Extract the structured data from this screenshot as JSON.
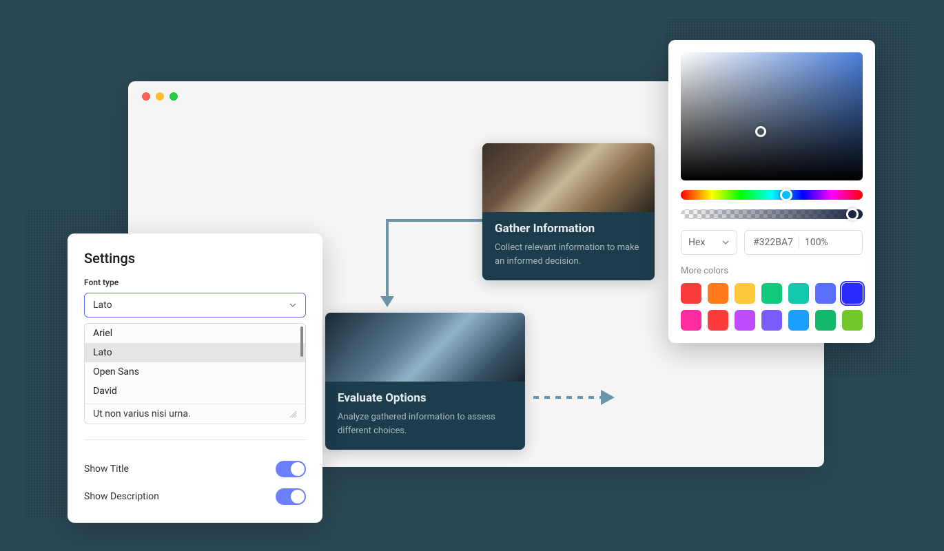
{
  "settings": {
    "title": "Settings",
    "font_type_label": "Font type",
    "font_selected": "Lato",
    "font_options": [
      "Ariel",
      "Lato",
      "Open Sans",
      "David"
    ],
    "textarea_value": "Ut non varius nisi urna.",
    "show_title_label": "Show Title",
    "show_title_on": true,
    "show_description_label": "Show Description",
    "show_description_on": true
  },
  "flow": {
    "card1": {
      "title": "Gather Information",
      "desc": "Collect relevant information to make an informed decision."
    },
    "card2": {
      "title": "Evaluate Options",
      "desc": "Analyze gathered information to assess different choices."
    }
  },
  "color_picker": {
    "format_label": "Hex",
    "hex_value": "#322BA7",
    "alpha_value": "100%",
    "more_colors_label": "More colors",
    "swatches": [
      "#fa3c3c",
      "#ff7a1a",
      "#ffc83d",
      "#10c97a",
      "#12c9b0",
      "#5b6fff",
      "#2a2aff",
      "#ff2aa0",
      "#ff3c3c",
      "#c04cff",
      "#7a5cff",
      "#1aa0ff",
      "#14b86a",
      "#72c82a"
    ],
    "selected_swatch_index": 6
  }
}
